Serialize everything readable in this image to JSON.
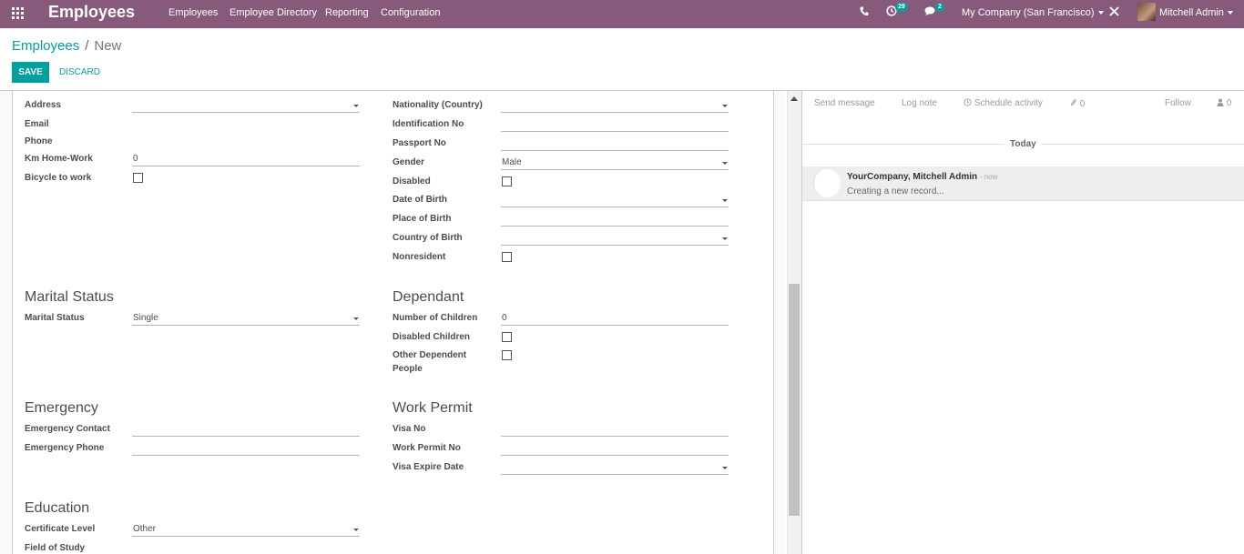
{
  "navbar": {
    "app_name": "Employees",
    "menu": [
      "Employees",
      "Employee Directory",
      "Reporting",
      "Configuration"
    ],
    "activity_count": "29",
    "message_count": "2",
    "company": "My Company (San Francisco)",
    "user": "Mitchell Admin",
    "colors": {
      "bar": "#875a7b",
      "accent": "#00a09d"
    }
  },
  "breadcrumb": {
    "parent": "Employees",
    "separator": "/",
    "current": "New"
  },
  "buttons": {
    "save": "SAVE",
    "discard": "DISCARD"
  },
  "left_col": {
    "address_label": "Address",
    "email_label": "Email",
    "phone_label": "Phone",
    "km_label": "Km Home-Work",
    "km_value": "0",
    "bicycle_label": "Bicycle to work"
  },
  "right_col": {
    "nationality_label": "Nationality (Country)",
    "identification_label": "Identification No",
    "passport_label": "Passport No",
    "gender_label": "Gender",
    "gender_value": "Male",
    "disabled_label": "Disabled",
    "dob_label": "Date of Birth",
    "pob_label": "Place of Birth",
    "cob_label": "Country of Birth",
    "nonresident_label": "Nonresident"
  },
  "marital": {
    "title": "Marital Status",
    "label": "Marital Status",
    "value": "Single"
  },
  "dependant": {
    "title": "Dependant",
    "children_label": "Number of Children",
    "children_value": "0",
    "disabled_children_label": "Disabled Children",
    "other_dependent_label_1": "Other Dependent",
    "other_dependent_label_2": "People"
  },
  "emergency": {
    "title": "Emergency",
    "contact_label": "Emergency Contact",
    "phone_label": "Emergency Phone"
  },
  "work_permit": {
    "title": "Work Permit",
    "visa_label": "Visa No",
    "permit_label": "Work Permit No",
    "visa_expire_label": "Visa Expire Date"
  },
  "education": {
    "title": "Education",
    "certificate_label": "Certificate Level",
    "certificate_value": "Other",
    "field_of_study_label": "Field of Study"
  },
  "chatter": {
    "send_message": "Send message",
    "log_note": "Log note",
    "schedule_activity": "Schedule activity",
    "attachments": "0",
    "follow": "Follow",
    "followers": "0",
    "today": "Today",
    "message": {
      "author": "YourCompany, Mitchell Admin",
      "date": "- now",
      "body": "Creating a new record..."
    }
  }
}
